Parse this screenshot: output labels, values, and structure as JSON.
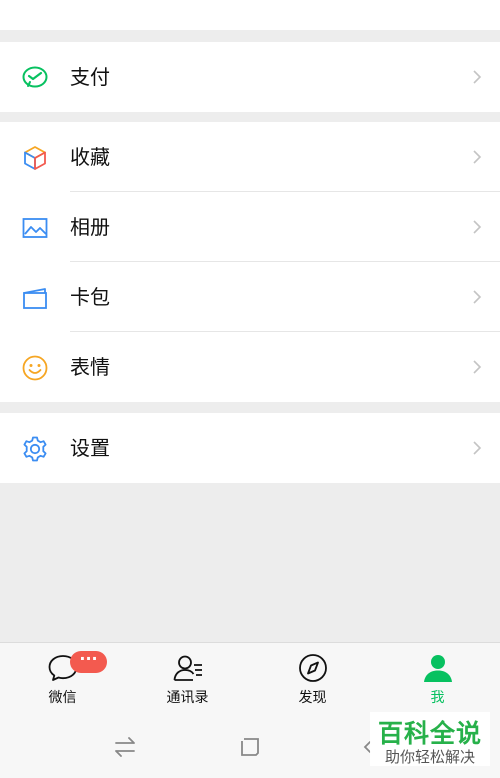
{
  "menu": {
    "pay": {
      "label": "支付",
      "icon": "wechat-pay-icon"
    },
    "favorites": {
      "label": "收藏",
      "icon": "cube-icon"
    },
    "album": {
      "label": "相册",
      "icon": "photo-icon"
    },
    "cards": {
      "label": "卡包",
      "icon": "card-wallet-icon"
    },
    "stickers": {
      "label": "表情",
      "icon": "smiley-icon"
    },
    "settings": {
      "label": "设置",
      "icon": "gear-icon"
    }
  },
  "tabbar": {
    "chats": {
      "label": "微信",
      "badge": "···",
      "icon": "chat-bubble-icon"
    },
    "contacts": {
      "label": "通讯录",
      "icon": "contacts-icon"
    },
    "discover": {
      "label": "发现",
      "icon": "compass-icon"
    },
    "me": {
      "label": "我",
      "icon": "person-icon",
      "active": true
    }
  },
  "colors": {
    "accent": "#07c160",
    "badge": "#f35a4f",
    "background": "#ededed"
  },
  "watermark": {
    "title": "百科全说",
    "subtitle": "助你轻松解决"
  }
}
